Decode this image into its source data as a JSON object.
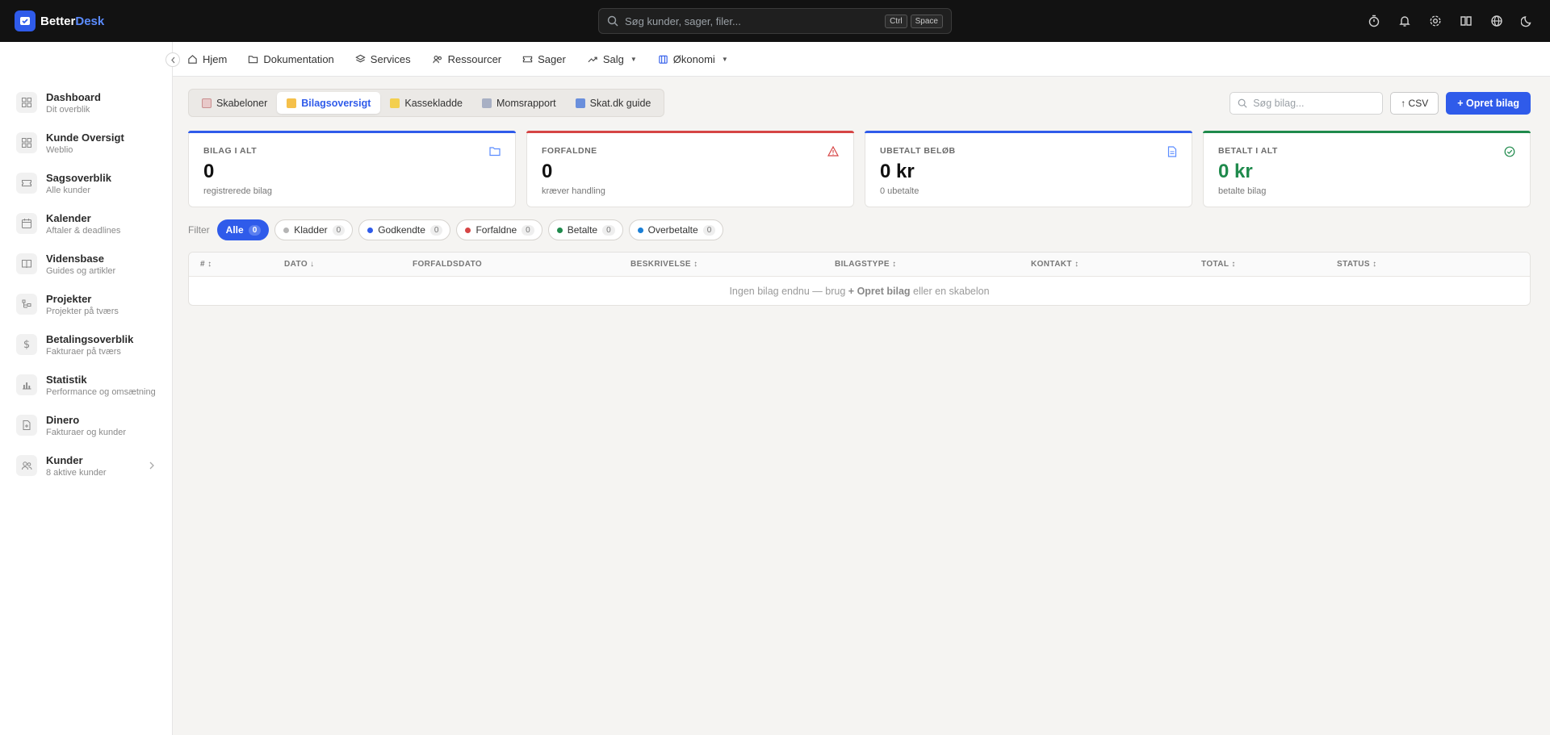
{
  "app": {
    "logo_main": "Better",
    "logo_accent": "Desk"
  },
  "search": {
    "placeholder": "Søg kunder, sager, filer...",
    "kbd1": "Ctrl",
    "kbd2": "Space"
  },
  "topbar_icons": [
    "timer-icon",
    "bell-icon",
    "gear-icon",
    "book-icon",
    "globe-icon",
    "moon-icon"
  ],
  "sidebar": {
    "items": [
      {
        "title": "Dashboard",
        "sub": "Dit overblik",
        "icon": "grid-icon"
      },
      {
        "title": "Kunde Oversigt",
        "sub": "Weblio",
        "icon": "grid-icon"
      },
      {
        "title": "Sagsoverblik",
        "sub": "Alle kunder",
        "icon": "ticket-icon"
      },
      {
        "title": "Kalender",
        "sub": "Aftaler & deadlines",
        "icon": "calendar-icon"
      },
      {
        "title": "Vidensbase",
        "sub": "Guides og artikler",
        "icon": "book-icon"
      },
      {
        "title": "Projekter",
        "sub": "Projekter på tværs",
        "icon": "project-icon"
      },
      {
        "title": "Betalingsoverblik",
        "sub": "Fakturaer på tværs",
        "icon": "dollar-icon"
      },
      {
        "title": "Statistik",
        "sub": "Performance og omsætning",
        "icon": "chart-icon"
      },
      {
        "title": "Dinero",
        "sub": "Fakturaer og kunder",
        "icon": "file-icon"
      },
      {
        "title": "Kunder",
        "sub": "8 aktive kunder",
        "icon": "users-icon"
      }
    ]
  },
  "nav": {
    "items": [
      "Hjem",
      "Dokumentation",
      "Services",
      "Ressourcer",
      "Sager",
      "Salg",
      "Økonomi"
    ]
  },
  "subtabs": {
    "items": [
      "Skabeloner",
      "Bilagsoversigt",
      "Kassekladde",
      "Momsrapport",
      "Skat.dk guide"
    ],
    "active": "Bilagsoversigt"
  },
  "actions": {
    "search_placeholder": "Søg bilag...",
    "csv_label": "↑ CSV",
    "new_label": "+ Opret bilag"
  },
  "cards": [
    {
      "label": "BILAG I ALT",
      "value": "0",
      "sub": "registrerede bilag",
      "accent": "#2f5bea"
    },
    {
      "label": "FORFALDNE",
      "value": "0",
      "sub": "kræver handling",
      "accent": "#d64545"
    },
    {
      "label": "UBETALT BELØB",
      "value": "0 kr",
      "sub": "0 ubetalte",
      "accent": "#2f5bea"
    },
    {
      "label": "BETALT I ALT",
      "value": "0 kr",
      "sub": "betalte bilag",
      "accent": "#1f8a4c"
    }
  ],
  "filters": {
    "label": "Filter",
    "chips": [
      {
        "label": "Alle",
        "count": "0",
        "color": ""
      },
      {
        "label": "Kladder",
        "count": "0",
        "color": "#b5b5b5"
      },
      {
        "label": "Godkendte",
        "count": "0",
        "color": "#2f5bea"
      },
      {
        "label": "Forfaldne",
        "count": "0",
        "color": "#d64545"
      },
      {
        "label": "Betalte",
        "count": "0",
        "color": "#1f8a4c"
      },
      {
        "label": "Overbetalte",
        "count": "0",
        "color": "#1b7fd6"
      }
    ]
  },
  "table": {
    "columns": [
      "# ↕",
      "DATO ↓",
      "FORFALDSDATO",
      "BESKRIVELSE ↕",
      "BILAGSTYPE ↕",
      "KONTAKT ↕",
      "TOTAL ↕",
      "STATUS ↕"
    ],
    "empty_pre": "Ingen bilag endnu — brug",
    "empty_strong": "+ Opret bilag",
    "empty_post": "eller en skabelon"
  }
}
